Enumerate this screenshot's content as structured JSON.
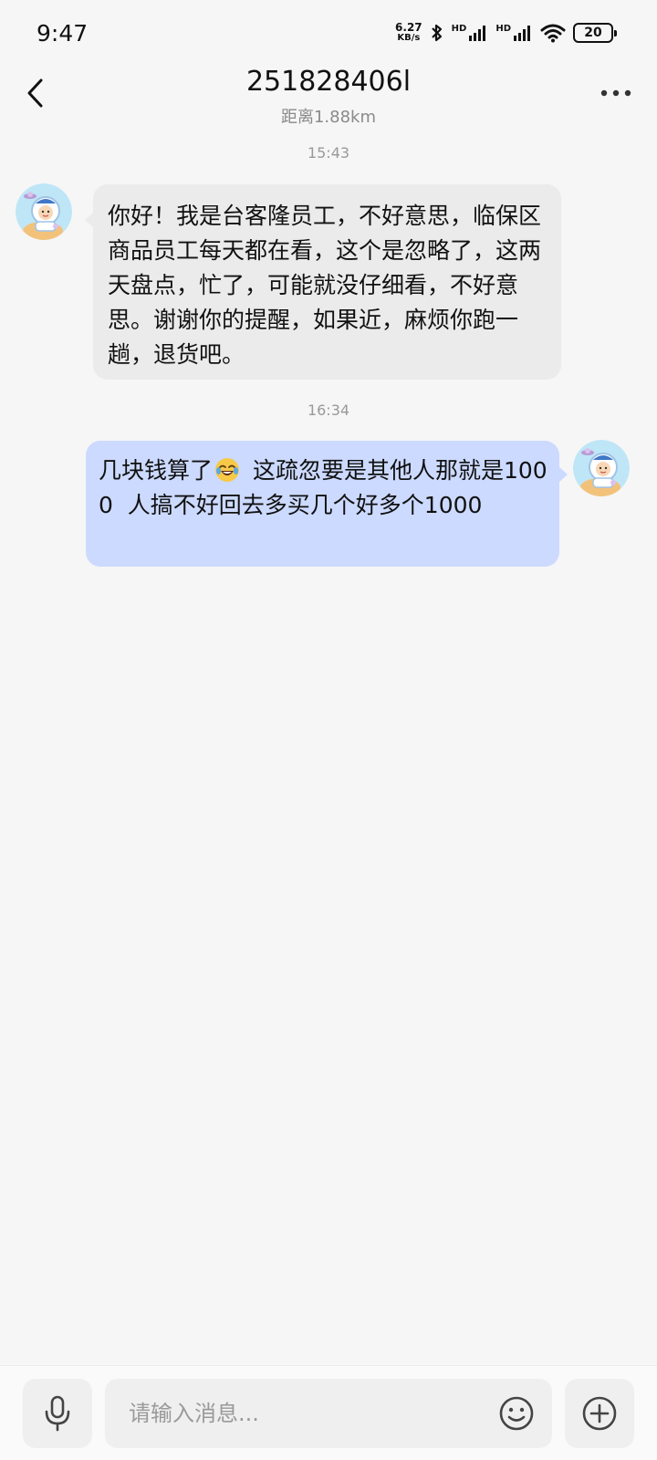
{
  "status_bar": {
    "time": "9:47",
    "net_speed_value": "6.27",
    "net_speed_unit": "KB/s",
    "hd1": "HD",
    "hd2": "HD",
    "battery": "20"
  },
  "header": {
    "title": "251828406l",
    "subtitle": "距离1.88km"
  },
  "messages": [
    {
      "timestamp": "15:43",
      "direction": "incoming",
      "text": "你好！我是台客隆员工，不好意思，临保区商品员工每天都在看，这个是忽略了，这两天盘点，忙了，可能就没仔细看，不好意思。谢谢你的提醒，如果近，麻烦你跑一趟，退货吧。"
    },
    {
      "timestamp": "16:34",
      "direction": "outgoing",
      "text_before_emoji": "几块钱算了",
      "emoji": "crying-laughing-emoji",
      "text_after_emoji": " 这疏忽要是其他人那就是1000  人搞不好回去多买几个好多个1000"
    }
  ],
  "input_bar": {
    "placeholder": "请输入消息..."
  },
  "colors": {
    "background": "#f6f6f6",
    "incoming_bubble": "#ebebeb",
    "outgoing_bubble": "#ccdaff",
    "timestamp_text": "#999999"
  }
}
